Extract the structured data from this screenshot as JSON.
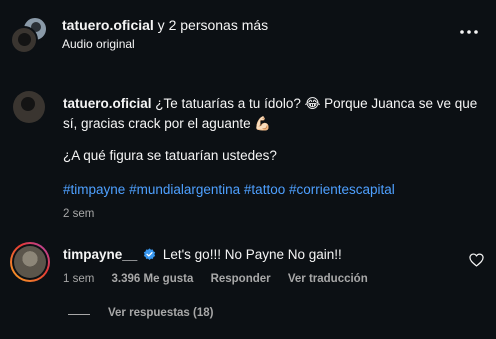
{
  "header": {
    "username": "tatuero.oficial",
    "others": " y 2 personas más",
    "subtitle": "Audio original"
  },
  "post": {
    "username": "tatuero.oficial",
    "caption_line1": " ¿Te tatuarías a tu ídolo? 😂 Porque Juanca se ve que sí, gracias crack por el aguante 💪🏻",
    "caption_line2": "¿A qué figura se tatuarían ustedes?",
    "hashtags": [
      "#timpayne",
      "#mundialargentina",
      "#tattoo",
      "#corrientescapital"
    ],
    "time": "2 sem"
  },
  "comment": {
    "username": "timpayne__",
    "text": "Let's go!!! No Payne No gain!!",
    "time": "1 sem",
    "likes": "3.396 Me gusta",
    "reply_label": "Responder",
    "translate_label": "Ver traducción",
    "view_replies": "Ver respuestas (18)"
  },
  "icons": {
    "more": "more-horizontal-icon",
    "verified": "verified-badge-icon",
    "like": "heart-outline-icon"
  },
  "colors": {
    "background": "#0c1014",
    "link": "#4ea0ff",
    "verified": "#3897f0",
    "muted": "#a8a8a8"
  }
}
